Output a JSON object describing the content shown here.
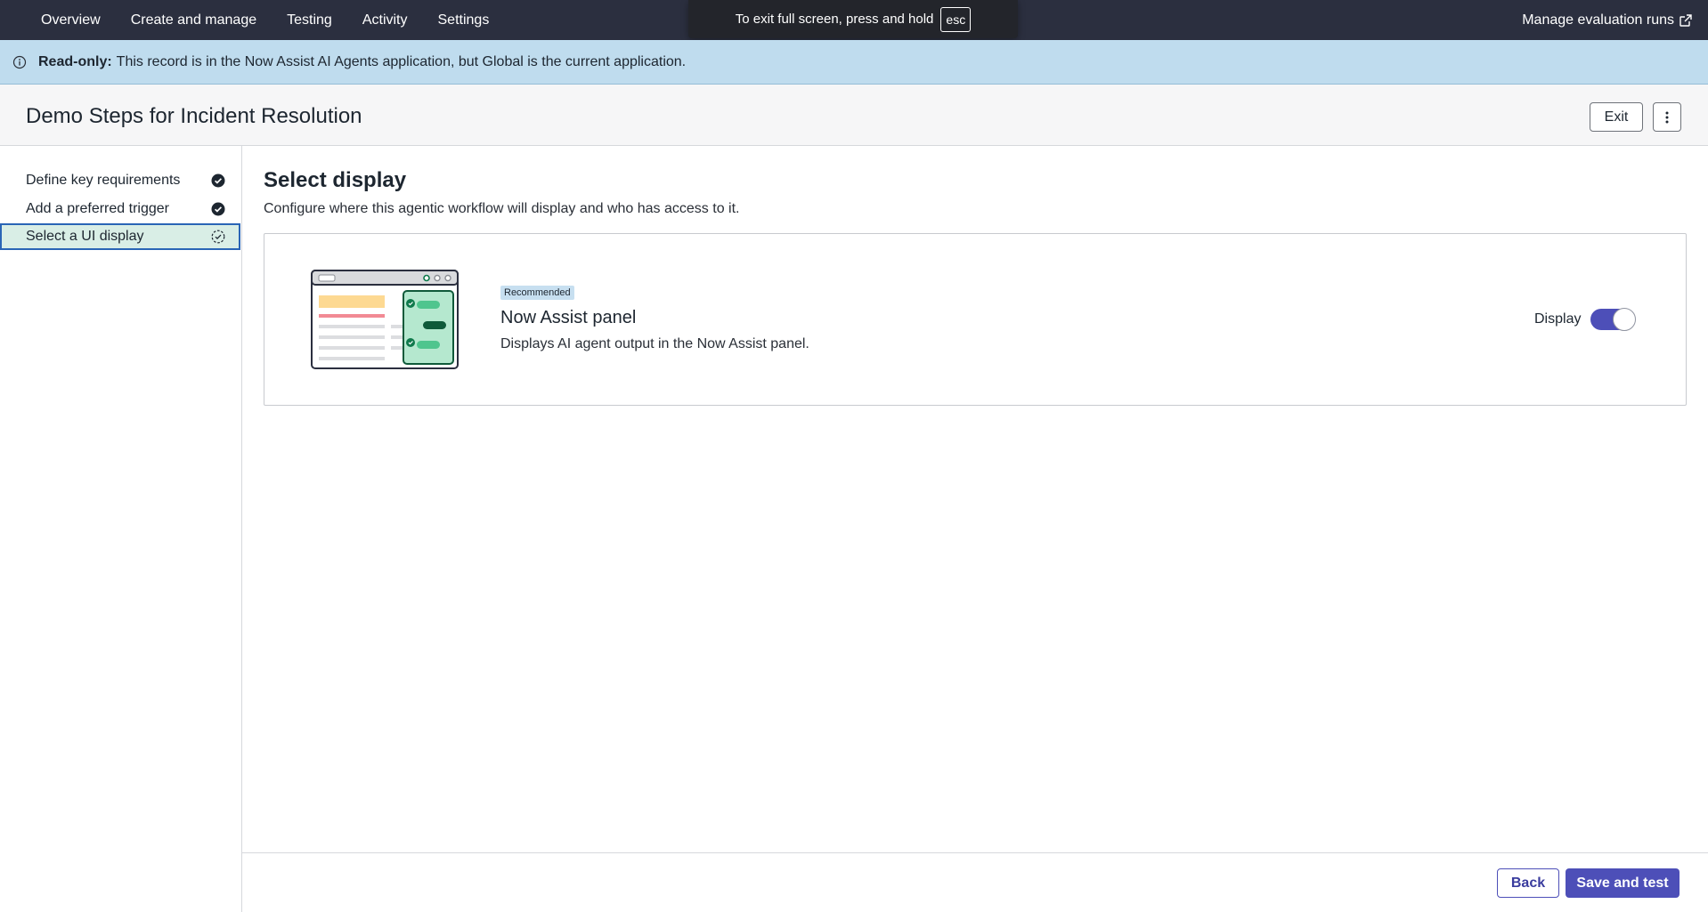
{
  "topnav": {
    "tabs": [
      "Overview",
      "Create and manage",
      "Testing",
      "Activity",
      "Settings"
    ],
    "manage_link": "Manage evaluation runs"
  },
  "fullscreen_toast": {
    "message": "To exit full screen, press and hold",
    "key": "esc"
  },
  "banner": {
    "label": "Read-only:",
    "message": "This record is in the Now Assist AI Agents application, but Global is the current application."
  },
  "header": {
    "title": "Demo Steps for Incident Resolution",
    "exit_label": "Exit"
  },
  "steps": [
    {
      "label": "Define key requirements",
      "status": "complete"
    },
    {
      "label": "Add a preferred trigger",
      "status": "complete"
    },
    {
      "label": "Select a UI display",
      "status": "in-progress"
    }
  ],
  "main": {
    "title": "Select display",
    "description": "Configure where this agentic workflow will display and who has access to it."
  },
  "card": {
    "badge": "Recommended",
    "name": "Now Assist panel",
    "description": "Displays AI agent output in the Now Assist panel.",
    "display_label": "Display",
    "display_enabled": true
  },
  "footer": {
    "back_label": "Back",
    "save_label": "Save and test"
  },
  "colors": {
    "nav_bg": "#2b2f3f",
    "banner_bg": "#bfdcee",
    "accent": "#4d4fb8",
    "active_step_bg": "#d9eee6"
  }
}
